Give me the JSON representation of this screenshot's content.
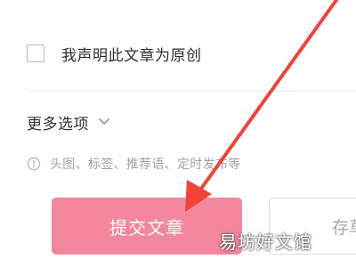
{
  "declare_original": {
    "label": "我声明此文章为原创",
    "checked": false
  },
  "more_options": {
    "label": "更多选项"
  },
  "hint": {
    "text": "头图、标签、推荐语、定时发布等"
  },
  "actions": {
    "submit_label": "提交文章",
    "draft_label": "存草稿"
  },
  "overlay": {
    "arrow_color": "#f0433a"
  },
  "watermark": {
    "text": "易坊好文馆"
  },
  "colors": {
    "submit_bg": "#f4879c",
    "hint_text": "#a3a3a3",
    "primary_text": "#2f2f2f"
  }
}
